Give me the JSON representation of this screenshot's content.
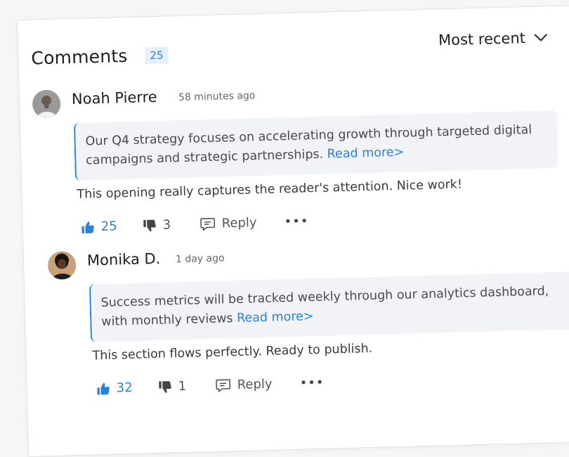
{
  "header": {
    "title": "Comments",
    "count": "25",
    "sort_label": "Most recent"
  },
  "comments": [
    {
      "author": "Noah Pierre",
      "time": "58 minutes ago",
      "quote": "Our Q4 strategy focuses on accelerating growth through targeted digital campaigns and strategic partnerships.",
      "read_more": "Read more>",
      "body": "This opening really captures the reader's attention. Nice work!",
      "likes": "25",
      "dislikes": "3",
      "reply_label": "Reply",
      "more": "•••"
    },
    {
      "author": "Monika D.",
      "time": "1 day ago",
      "quote": "Success metrics will be tracked weekly through our analytics dashboard, with monthly reviews",
      "read_more": "Read more>",
      "body": "This section flows perfectly. Ready to publish.",
      "likes": "32",
      "dislikes": "1",
      "reply_label": "Reply",
      "more": "•••"
    }
  ],
  "colors": {
    "accent": "#2b7fd8",
    "quote_bg": "#f1f3f7",
    "badge_bg": "#e6f0fb"
  },
  "icons": {
    "like": "thumbs-up-icon",
    "dislike": "thumbs-down-icon",
    "reply": "speech-bubble-icon",
    "more": "more-dots-icon",
    "sort": "chevron-down-icon"
  }
}
